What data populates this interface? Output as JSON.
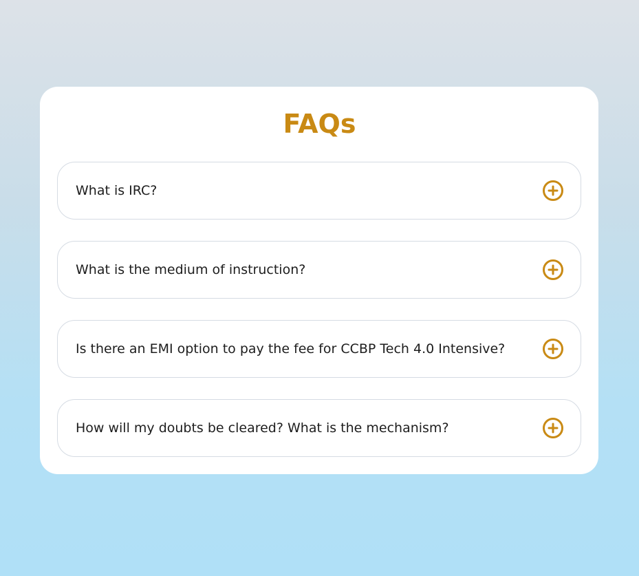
{
  "page": {
    "title": "FAQs",
    "accent_color": "#c98a14"
  },
  "faqs": [
    {
      "question": "What is IRC?",
      "icon": "plus-circle-icon"
    },
    {
      "question": "What is the medium of instruction?",
      "icon": "plus-circle-icon"
    },
    {
      "question": "Is there an EMI option to pay the fee for CCBP Tech 4.0 Intensive?",
      "icon": "plus-circle-icon"
    },
    {
      "question": "How will my doubts be cleared? What is the mechanism?",
      "icon": "plus-circle-icon"
    }
  ]
}
